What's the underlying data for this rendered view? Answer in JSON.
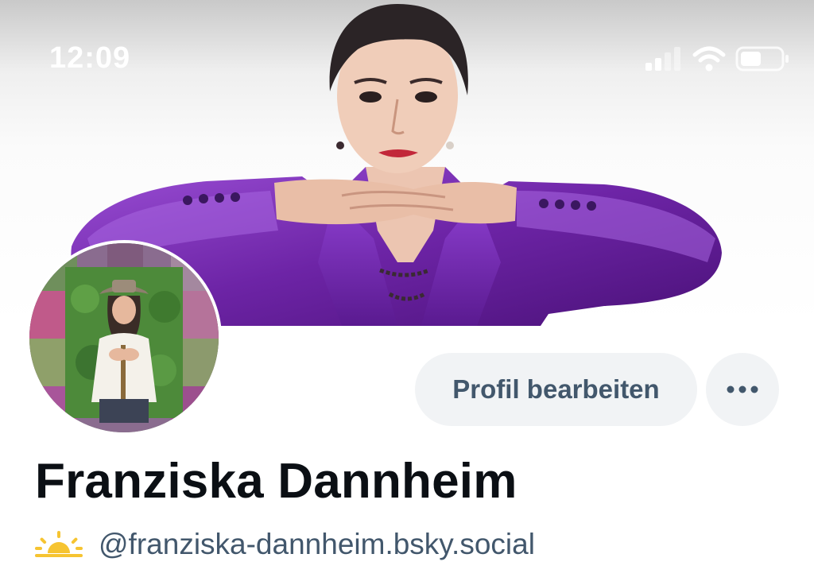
{
  "status_bar": {
    "time": "12:09",
    "icons": [
      "cellular-signal-icon",
      "wifi-icon",
      "battery-icon"
    ]
  },
  "profile": {
    "banner": "banner-image",
    "avatar": "avatar-image",
    "display_name": "Franziska Dannheim",
    "handle_emoji": "sun-emoji-icon",
    "handle": "@franziska-dannheim.bsky.social"
  },
  "actions": {
    "edit_profile_label": "Profil bearbeiten",
    "more_icon": "more-options-icon"
  },
  "colors": {
    "button_bg": "#f1f3f5",
    "button_text": "#42576c",
    "name_text": "#0b0f14",
    "handle_text": "#42576c",
    "banner_jacket": "#7a2fb0"
  }
}
